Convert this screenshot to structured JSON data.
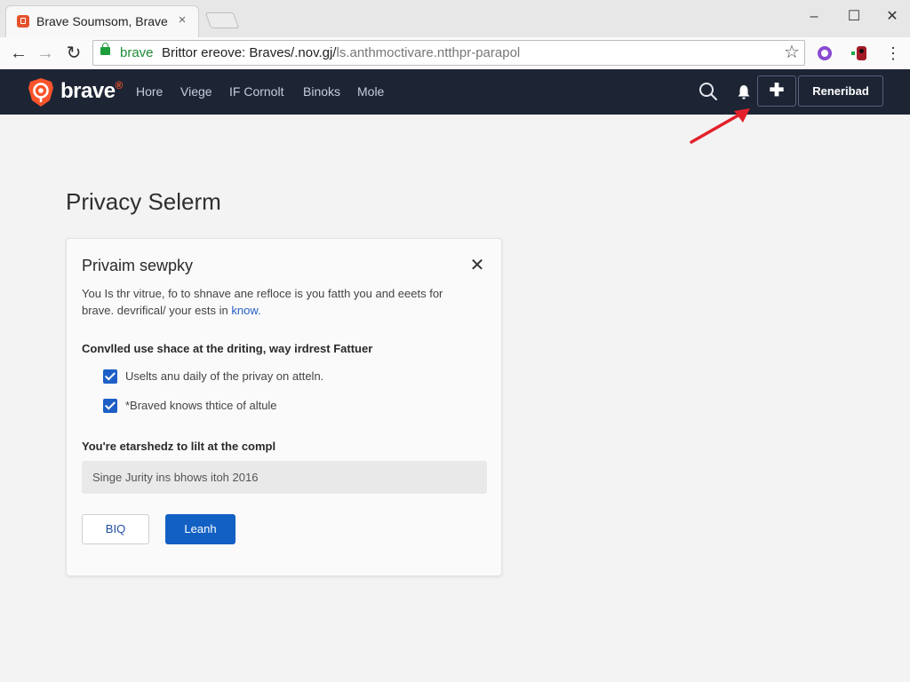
{
  "browser": {
    "tab_title": "Brave Soumsom, Brave",
    "tab_close": "×",
    "window_controls": {
      "minimize": "–",
      "maximize": "☐",
      "close": "✕"
    },
    "toolbar": {
      "back": "←",
      "forward": "→",
      "reload": "↻",
      "url_scheme": "brave",
      "url_host": "Brittor ereove: Braves/.nov.gj/",
      "url_path": "ls.anthmoctivare.ntthpr-parapol",
      "bookmark": "☆",
      "menu": "⋮"
    }
  },
  "site": {
    "logo_text": "brave",
    "logo_mark": "®",
    "nav_links": [
      "Hore",
      "Viege",
      "IF Cornolt",
      "Binoks",
      "Mole"
    ],
    "plus_label": "✚",
    "signup_label": "Reneribad",
    "brand_color": "#fb542b"
  },
  "page": {
    "title": "Privacy Selerm",
    "dialog": {
      "title": "Privaim sewpky",
      "close": "✕",
      "description": "You Is thr vitrue, fo to shnave ane refloce is you fatth you and eeets for brave. devrifical/ your ests in",
      "description_link": "know.",
      "section1_heading": "Convlled use shace at the driting, way irdrest Fattuer",
      "checkboxes": [
        {
          "label": "Uselts anu daily of the privay on atteln.",
          "checked": true
        },
        {
          "label": "*Braved knows thtice of altule",
          "checked": true
        }
      ],
      "section2_heading": "You're etarshedz to lilt at the compl",
      "field_value": "Singe Jurity ins bhows itoh 2016",
      "secondary_button": "BIQ",
      "primary_button": "Leanh"
    }
  }
}
